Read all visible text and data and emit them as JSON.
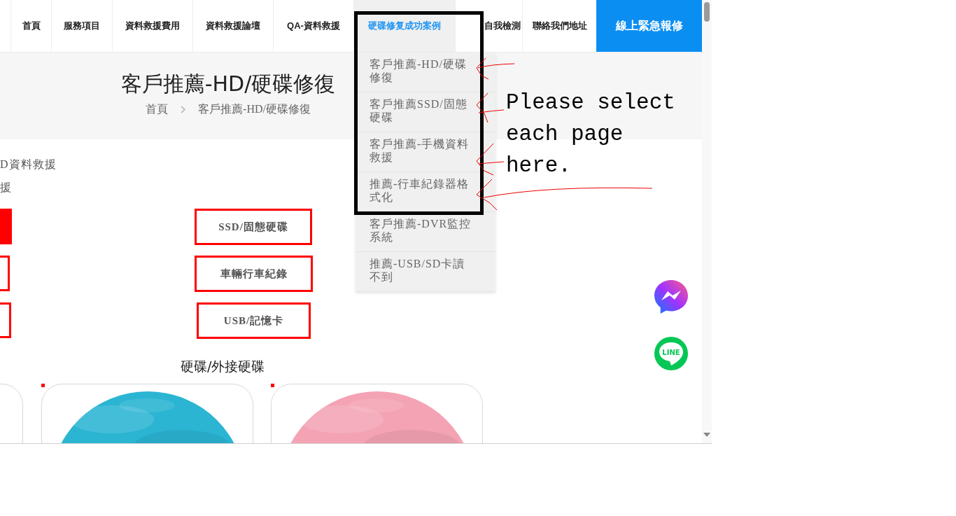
{
  "nav": [
    {
      "label": "首頁",
      "kind": "link",
      "selected": false
    },
    {
      "label": "服務項目",
      "kind": "link",
      "selected": false
    },
    {
      "label": "資料救援費用",
      "kind": "link",
      "selected": false
    },
    {
      "label": "資料救援論壇",
      "kind": "link",
      "selected": false
    },
    {
      "label": "QA-資料救援",
      "kind": "link",
      "selected": false
    },
    {
      "label": "硬碟修复成功案例",
      "kind": "link",
      "selected": true
    },
    {
      "label": "自我檢測",
      "kind": "link",
      "selected": false
    },
    {
      "label": "聯絡我們地址",
      "kind": "link",
      "selected": false
    },
    {
      "label": "線上緊急報修",
      "kind": "cta",
      "selected": false
    }
  ],
  "dropdown": [
    "客戶推薦-HD/硬碟修復",
    "客戶推薦SSD/固態硬碟",
    "客戶推薦-手機資料救援",
    "推薦-行車紀錄器格式化",
    "客戶推薦-DVR監控系統",
    "推薦-USB/SD卡讀不到"
  ],
  "page_header": {
    "title": "客戶推薦-HD/硬碟修復",
    "breadcrumb": [
      "首頁",
      "客戶推薦-HD/硬碟修復"
    ]
  },
  "partial_links": [
    "D資料救援",
    "援"
  ],
  "left_buttons": [
    {
      "filled": true
    },
    {
      "filled": false
    },
    {
      "filled": false
    }
  ],
  "category_buttons": [
    "SSD/固態硬碟",
    "車輛行車紀錄",
    "USB/記憶卡"
  ],
  "section_title": "硬碟/外接硬碟",
  "cards": [
    {
      "kind": "picture"
    },
    {
      "kind": "picture"
    }
  ],
  "annotation": {
    "text": "Please select each page here."
  },
  "chat_buttons": [
    {
      "kind": "messenger"
    },
    {
      "kind": "line",
      "label": "LINE"
    }
  ]
}
